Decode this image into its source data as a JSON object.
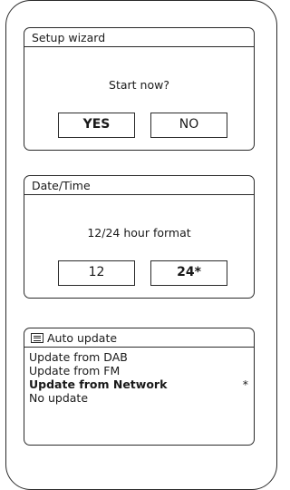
{
  "setup_wizard": {
    "title": "Setup wizard",
    "prompt": "Start now?",
    "options": [
      {
        "label": "YES",
        "selected": true
      },
      {
        "label": "NO",
        "selected": false
      }
    ]
  },
  "date_time": {
    "title": "Date/Time",
    "prompt": "12/24 hour format",
    "options": [
      {
        "label": "12",
        "selected": false
      },
      {
        "label": "24*",
        "selected": true
      }
    ]
  },
  "auto_update": {
    "title": "Auto update",
    "title_icon": "menu-list-icon",
    "items": [
      {
        "label": "Update from DAB",
        "selected": false,
        "marker": ""
      },
      {
        "label": "Update from FM",
        "selected": false,
        "marker": ""
      },
      {
        "label": "Update from Network",
        "selected": true,
        "marker": "*"
      },
      {
        "label": "No update",
        "selected": false,
        "marker": ""
      }
    ]
  }
}
